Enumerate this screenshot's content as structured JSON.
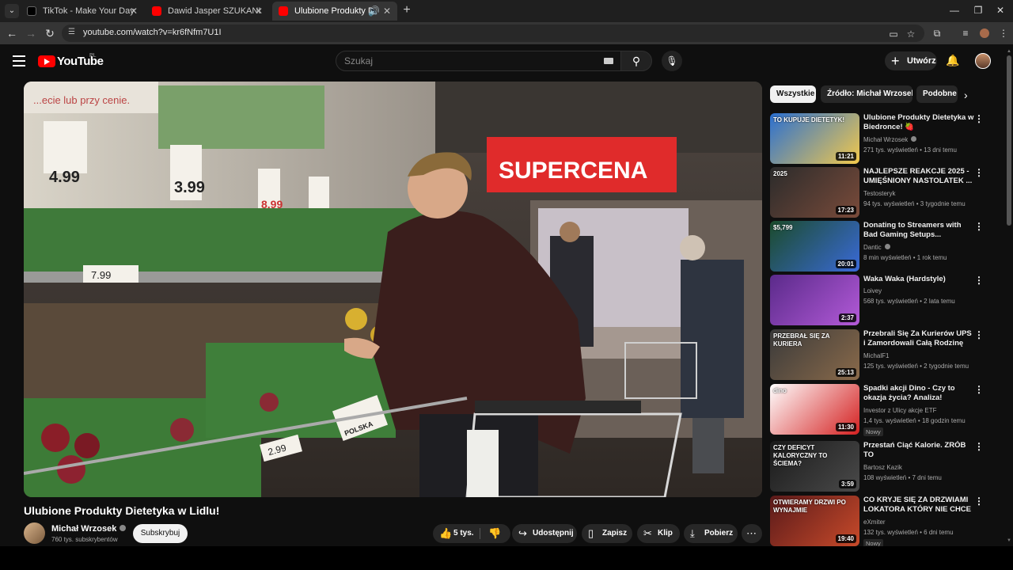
{
  "browser": {
    "tabs": [
      {
        "label": "TikTok - Make Your Day",
        "favicon_color": "#000000",
        "active": false
      },
      {
        "label": "Dawid Jasper SZUKANIE MIŁOŚ",
        "favicon_color": "#ff0000",
        "active": false
      },
      {
        "label": "Ulubione Produkty Dietetyk",
        "favicon_color": "#ff0000",
        "active": true
      }
    ],
    "url": "youtube.com/watch?v=kr6fNfm7U1I"
  },
  "header": {
    "logo": "YouTube",
    "country_code": "PL",
    "search_placeholder": "Szukaj",
    "create_label": "Utwórz"
  },
  "video": {
    "title": "Ulubione Produkty Dietetyka w Lidlu!",
    "channel": "Michał Wrzosek",
    "subscribers": "760 tys. subskrybentów",
    "subscribe_label": "Subskrybuj",
    "likes": "5 tys.",
    "share_label": "Udostępnij",
    "save_label": "Zapisz",
    "clip_label": "Klip",
    "download_label": "Pobierz",
    "frame_texts": {
      "sign": "SUPERCENA",
      "price_1": "4.99",
      "price_2": "3.99",
      "price_3": "8.99",
      "price_4": "7.99",
      "shelf_price_1": "7.99",
      "shelf_price_2": "2.99",
      "flag_label": "POLSKA",
      "banner": "...ecie lub przy cenie."
    }
  },
  "sidebar": {
    "chips": [
      "Wszystkie",
      "Źródło: Michał Wrzosek",
      "Podobne"
    ],
    "recommendations": [
      {
        "title": "Ulubione Produkty Dietetyka w Biedronce! 🍓",
        "channel": "Michał Wrzosek",
        "verified": true,
        "meta": "271 tys. wyświetleń • 13 dni temu",
        "duration": "11:21",
        "thumb_text": "TO KUPUJE DIETETYK!",
        "thumb_colors": [
          "#2a6fd1",
          "#f2c94c"
        ],
        "badge": ""
      },
      {
        "title": "NAJLEPSZE REAKCJE 2025 - UMIĘŚNIONY NASTOLATEK ...",
        "channel": "Testosteryk",
        "verified": false,
        "meta": "94 tys. wyświetleń • 3 tygodnie temu",
        "duration": "17:23",
        "thumb_text": "2025",
        "thumb_colors": [
          "#2b2b2b",
          "#7a4b3a"
        ],
        "badge": ""
      },
      {
        "title": "Donating to Streamers with Bad Gaming Setups...",
        "channel": "Dantic",
        "verified": true,
        "meta": "8 min wyświetleń • 1 rok temu",
        "duration": "20:01",
        "thumb_text": "$5,799",
        "thumb_colors": [
          "#1b4b2b",
          "#3a6ad8"
        ],
        "badge": ""
      },
      {
        "title": "Waka Waka (Hardstyle)",
        "channel": "Loivey",
        "verified": false,
        "meta": "568 tys. wyświetleń • 2 lata temu",
        "duration": "2:37",
        "thumb_text": "",
        "thumb_colors": [
          "#5a2a8a",
          "#b35ad8"
        ],
        "badge": ""
      },
      {
        "title": "Przebrali Się Za Kurierów UPS i Zamordowali Całą Rodzinę",
        "channel": "MichalF1",
        "verified": false,
        "meta": "125 tys. wyświetleń • 2 tygodnie temu",
        "duration": "25:13",
        "thumb_text": "PRZEBRAŁ SIĘ ZA KURIERA",
        "thumb_colors": [
          "#3a3a3a",
          "#8a6a4a"
        ],
        "badge": ""
      },
      {
        "title": "Spadki akcji Dino - Czy to okazja życia? Analiza!",
        "channel": "Investor z Ulicy akcje ETF",
        "verified": false,
        "meta": "1,4 tys. wyświetleń • 18 godzin temu",
        "duration": "11:30",
        "thumb_text": "dino",
        "thumb_colors": [
          "#ffffff",
          "#d42020"
        ],
        "badge": "Nowy"
      },
      {
        "title": "Przestań Ciąć Kalorie. ZRÓB TO",
        "channel": "Bartosz Kazik",
        "verified": false,
        "meta": "108 wyświetleń • 7 dni temu",
        "duration": "3:59",
        "thumb_text": "CZY DEFICYT KALORYCZNY TO ŚCIEMA?",
        "thumb_colors": [
          "#1a1a1a",
          "#4a4a4a"
        ],
        "badge": ""
      },
      {
        "title": "CO KRYJE SIĘ ZA DRZWIAMI LOKATORA KTÓRY NIE CHCE ...",
        "channel": "eXmiter",
        "verified": false,
        "meta": "132 tys. wyświetleń • 6 dni temu",
        "duration": "19:40",
        "thumb_text": "OTWIERAMY DRZWI PO WYNAJMIE",
        "thumb_colors": [
          "#5a1a1a",
          "#c84a2a"
        ],
        "badge": "Nowy"
      }
    ]
  }
}
